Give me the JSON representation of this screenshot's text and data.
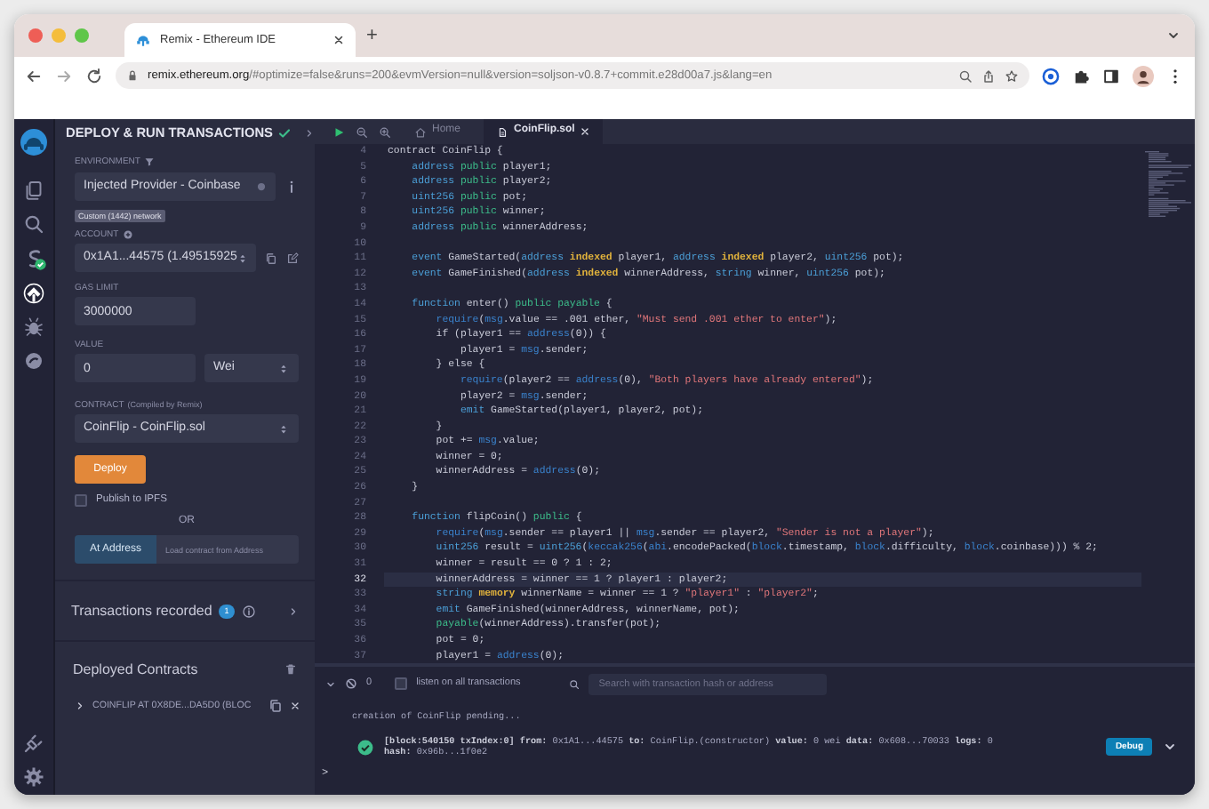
{
  "browser": {
    "tab_title": "Remix - Ethereum IDE",
    "new_tab": "+",
    "url_host": "remix.ethereum.org",
    "url_rest": "/#optimize=false&runs=200&evmVersion=null&version=soljson-v0.8.7+commit.e28d00a7.js&lang=en"
  },
  "activity_bar": {
    "top": [
      {
        "kind": "files",
        "selected": false
      },
      {
        "kind": "search",
        "selected": false
      },
      {
        "kind": "compiler",
        "selected": false
      },
      {
        "kind": "deploy",
        "selected": true
      },
      {
        "kind": "debugger",
        "selected": false
      },
      {
        "kind": "learn",
        "selected": false
      }
    ],
    "bottom": [
      {
        "kind": "plugins",
        "selected": false
      },
      {
        "kind": "settings",
        "selected": false
      }
    ]
  },
  "deploy_panel": {
    "title": "DEPLOY & RUN TRANSACTIONS",
    "environment": {
      "label": "ENVIRONMENT",
      "value": "Injected Provider - Coinbase",
      "network": "Custom (1442) network"
    },
    "account": {
      "label": "ACCOUNT",
      "value": "0x1A1...44575 (1.49515925"
    },
    "gas_limit": {
      "label": "GAS LIMIT",
      "value": "3000000"
    },
    "value": {
      "label": "VALUE",
      "value": "0",
      "unit": "Wei"
    },
    "contract": {
      "label": "CONTRACT",
      "note": "(Compiled by Remix)",
      "value": "CoinFlip - CoinFlip.sol"
    },
    "deploy_button": "Deploy",
    "publish": {
      "label": "Publish to IPFS",
      "checked": false
    },
    "or": "OR",
    "at_address": {
      "button": "At Address",
      "placeholder": "Load contract from Address"
    },
    "transactions": {
      "label": "Transactions recorded",
      "count": "1"
    },
    "deployed": {
      "title": "Deployed Contracts",
      "instances": [
        {
          "label": "COINFLIP AT 0X8DE...DA5D0 (BLOC",
          "expanded": false
        }
      ]
    }
  },
  "editor": {
    "tabs": [
      {
        "kind": "home",
        "label": "Home",
        "selected": false
      },
      {
        "kind": "file",
        "label": "CoinFlip.sol",
        "selected": true
      }
    ],
    "lines": [
      {
        "number": "4",
        "active": false,
        "tokens": [
          {
            "kind": "plain",
            "text": "contract CoinFlip {"
          }
        ]
      },
      {
        "number": "5",
        "active": false,
        "tokens": [
          {
            "kind": "kw",
            "text": "    address "
          },
          {
            "kind": "mod",
            "text": "public"
          },
          {
            "kind": "plain",
            "text": " player1;"
          }
        ]
      },
      {
        "number": "6",
        "active": false,
        "tokens": [
          {
            "kind": "kw",
            "text": "    address "
          },
          {
            "kind": "mod",
            "text": "public"
          },
          {
            "kind": "plain",
            "text": " player2;"
          }
        ]
      },
      {
        "number": "7",
        "active": false,
        "tokens": [
          {
            "kind": "kw",
            "text": "    uint256 "
          },
          {
            "kind": "mod",
            "text": "public"
          },
          {
            "kind": "plain",
            "text": " pot;"
          }
        ]
      },
      {
        "number": "8",
        "active": false,
        "tokens": [
          {
            "kind": "kw",
            "text": "    uint256 "
          },
          {
            "kind": "mod",
            "text": "public"
          },
          {
            "kind": "plain",
            "text": " winner;"
          }
        ]
      },
      {
        "number": "9",
        "active": false,
        "tokens": [
          {
            "kind": "kw",
            "text": "    address "
          },
          {
            "kind": "mod",
            "text": "public"
          },
          {
            "kind": "plain",
            "text": " winnerAddress;"
          }
        ]
      },
      {
        "number": "10",
        "active": false
      },
      {
        "number": "11",
        "active": false,
        "tokens": [
          {
            "kind": "kw",
            "text": "    event "
          },
          {
            "kind": "plain",
            "text": "GameStarted("
          },
          {
            "kind": "kw",
            "text": "address "
          },
          {
            "kind": "hl",
            "text": "indexed"
          },
          {
            "kind": "plain",
            "text": " player1, "
          },
          {
            "kind": "kw",
            "text": "address "
          },
          {
            "kind": "hl",
            "text": "indexed"
          },
          {
            "kind": "plain",
            "text": " player2, "
          },
          {
            "kind": "kw",
            "text": "uint256 "
          },
          {
            "kind": "plain",
            "text": "pot);"
          }
        ]
      },
      {
        "number": "12",
        "active": false,
        "tokens": [
          {
            "kind": "kw",
            "text": "    event "
          },
          {
            "kind": "plain",
            "text": "GameFinished("
          },
          {
            "kind": "kw",
            "text": "address "
          },
          {
            "kind": "hl",
            "text": "indexed"
          },
          {
            "kind": "plain",
            "text": " winnerAddress, "
          },
          {
            "kind": "kw",
            "text": "string "
          },
          {
            "kind": "plain",
            "text": "winner, "
          },
          {
            "kind": "kw",
            "text": "uint256 "
          },
          {
            "kind": "plain",
            "text": "pot);"
          }
        ]
      },
      {
        "number": "13",
        "active": false
      },
      {
        "number": "14",
        "active": false,
        "tokens": [
          {
            "kind": "kw",
            "text": "    function "
          },
          {
            "kind": "plain",
            "text": "enter() "
          },
          {
            "kind": "mod",
            "text": "public payable"
          },
          {
            "kind": "plain",
            "text": " {"
          }
        ]
      },
      {
        "number": "15",
        "active": false,
        "tokens": [
          {
            "kind": "fn",
            "text": "        require"
          },
          {
            "kind": "plain",
            "text": "("
          },
          {
            "kind": "fn",
            "text": "msg"
          },
          {
            "kind": "plain",
            "text": ".value == .001 ether, "
          },
          {
            "kind": "str",
            "text": "\"Must send .001 ether to enter\""
          },
          {
            "kind": "plain",
            "text": ");"
          }
        ]
      },
      {
        "number": "16",
        "active": false,
        "tokens": [
          {
            "kind": "plain",
            "text": "        if (player1 == "
          },
          {
            "kind": "fn",
            "text": "address"
          },
          {
            "kind": "plain",
            "text": "(0)) {"
          }
        ]
      },
      {
        "number": "17",
        "active": false,
        "tokens": [
          {
            "kind": "plain",
            "text": "            player1 = "
          },
          {
            "kind": "fn",
            "text": "msg"
          },
          {
            "kind": "plain",
            "text": ".sender;"
          }
        ]
      },
      {
        "number": "18",
        "active": false,
        "tokens": [
          {
            "kind": "plain",
            "text": "        } else {"
          }
        ]
      },
      {
        "number": "19",
        "active": false,
        "tokens": [
          {
            "kind": "fn",
            "text": "            require"
          },
          {
            "kind": "plain",
            "text": "(player2 == "
          },
          {
            "kind": "fn",
            "text": "address"
          },
          {
            "kind": "plain",
            "text": "(0), "
          },
          {
            "kind": "str",
            "text": "\"Both players have already entered\""
          },
          {
            "kind": "plain",
            "text": ");"
          }
        ]
      },
      {
        "number": "20",
        "active": false,
        "tokens": [
          {
            "kind": "plain",
            "text": "            player2 = "
          },
          {
            "kind": "fn",
            "text": "msg"
          },
          {
            "kind": "plain",
            "text": ".sender;"
          }
        ]
      },
      {
        "number": "21",
        "active": false,
        "tokens": [
          {
            "kind": "kw",
            "text": "            emit "
          },
          {
            "kind": "plain",
            "text": "GameStarted(player1, player2, pot);"
          }
        ]
      },
      {
        "number": "22",
        "active": false,
        "tokens": [
          {
            "kind": "plain",
            "text": "        }"
          }
        ]
      },
      {
        "number": "23",
        "active": false,
        "tokens": [
          {
            "kind": "plain",
            "text": "        pot += "
          },
          {
            "kind": "fn",
            "text": "msg"
          },
          {
            "kind": "plain",
            "text": ".value;"
          }
        ]
      },
      {
        "number": "24",
        "active": false,
        "tokens": [
          {
            "kind": "plain",
            "text": "        winner = 0;"
          }
        ]
      },
      {
        "number": "25",
        "active": false,
        "tokens": [
          {
            "kind": "plain",
            "text": "        winnerAddress = "
          },
          {
            "kind": "fn",
            "text": "address"
          },
          {
            "kind": "plain",
            "text": "(0);"
          }
        ]
      },
      {
        "number": "26",
        "active": false,
        "tokens": [
          {
            "kind": "plain",
            "text": "    }"
          }
        ]
      },
      {
        "number": "27",
        "active": false
      },
      {
        "number": "28",
        "active": false,
        "tokens": [
          {
            "kind": "kw",
            "text": "    function "
          },
          {
            "kind": "plain",
            "text": "flipCoin() "
          },
          {
            "kind": "mod",
            "text": "public"
          },
          {
            "kind": "plain",
            "text": " {"
          }
        ]
      },
      {
        "number": "29",
        "active": false,
        "tokens": [
          {
            "kind": "fn",
            "text": "        require"
          },
          {
            "kind": "plain",
            "text": "("
          },
          {
            "kind": "fn",
            "text": "msg"
          },
          {
            "kind": "plain",
            "text": ".sender == player1 || "
          },
          {
            "kind": "fn",
            "text": "msg"
          },
          {
            "kind": "plain",
            "text": ".sender == player2, "
          },
          {
            "kind": "str",
            "text": "\"Sender is not a player\""
          },
          {
            "kind": "plain",
            "text": ");"
          }
        ]
      },
      {
        "number": "30",
        "active": false,
        "tokens": [
          {
            "kind": "kw",
            "text": "        uint256 "
          },
          {
            "kind": "plain",
            "text": "result = "
          },
          {
            "kind": "kw",
            "text": "uint256"
          },
          {
            "kind": "plain",
            "text": "("
          },
          {
            "kind": "fn",
            "text": "keccak256"
          },
          {
            "kind": "plain",
            "text": "("
          },
          {
            "kind": "fn",
            "text": "abi"
          },
          {
            "kind": "plain",
            "text": ".encodePacked("
          },
          {
            "kind": "fn",
            "text": "block"
          },
          {
            "kind": "plain",
            "text": ".timestamp, "
          },
          {
            "kind": "fn",
            "text": "block"
          },
          {
            "kind": "plain",
            "text": ".difficulty, "
          },
          {
            "kind": "fn",
            "text": "block"
          },
          {
            "kind": "plain",
            "text": ".coinbase))) % 2;"
          }
        ]
      },
      {
        "number": "31",
        "active": false,
        "tokens": [
          {
            "kind": "plain",
            "text": "        winner = result == 0 ? 1 : 2;"
          }
        ]
      },
      {
        "number": "32",
        "active": true,
        "tokens": [
          {
            "kind": "plain",
            "text": "        winnerAddress = winner == 1 ? player1 : player2;"
          }
        ]
      },
      {
        "number": "33",
        "active": false,
        "tokens": [
          {
            "kind": "kw",
            "text": "        string "
          },
          {
            "kind": "hl",
            "text": "memory"
          },
          {
            "kind": "plain",
            "text": " winnerName = winner == 1 ? "
          },
          {
            "kind": "str",
            "text": "\"player1\""
          },
          {
            "kind": "plain",
            "text": " : "
          },
          {
            "kind": "str",
            "text": "\"player2\""
          },
          {
            "kind": "plain",
            "text": ";"
          }
        ]
      },
      {
        "number": "34",
        "active": false,
        "tokens": [
          {
            "kind": "kw",
            "text": "        emit "
          },
          {
            "kind": "plain",
            "text": "GameFinished(winnerAddress, winnerName, pot);"
          }
        ]
      },
      {
        "number": "35",
        "active": false,
        "tokens": [
          {
            "kind": "mod",
            "text": "        payable"
          },
          {
            "kind": "plain",
            "text": "(winnerAddress).transfer(pot);"
          }
        ]
      },
      {
        "number": "36",
        "active": false,
        "tokens": [
          {
            "kind": "plain",
            "text": "        pot = 0;"
          }
        ]
      },
      {
        "number": "37",
        "active": false,
        "tokens": [
          {
            "kind": "plain",
            "text": "        player1 = "
          },
          {
            "kind": "fn",
            "text": "address"
          },
          {
            "kind": "plain",
            "text": "(0);"
          }
        ]
      }
    ]
  },
  "terminal": {
    "pending_count": "0",
    "listen": {
      "label": "listen on all transactions",
      "checked": false
    },
    "search_placeholder": "Search with transaction hash or address",
    "log": [
      {
        "kind": "info",
        "lines": [
          "creation of CoinFlip pending..."
        ]
      },
      {
        "kind": "tx",
        "lines": [
          "**[block:540150 txIndex:0] from:** 0x1A1...44575 **to:** CoinFlip.(constructor) **value:** 0 wei **data:** 0x608...70033 **logs:** 0",
          "**hash:** 0x96b...1f0e2"
        ],
        "button": "Debug"
      }
    ],
    "prompt": ">"
  }
}
